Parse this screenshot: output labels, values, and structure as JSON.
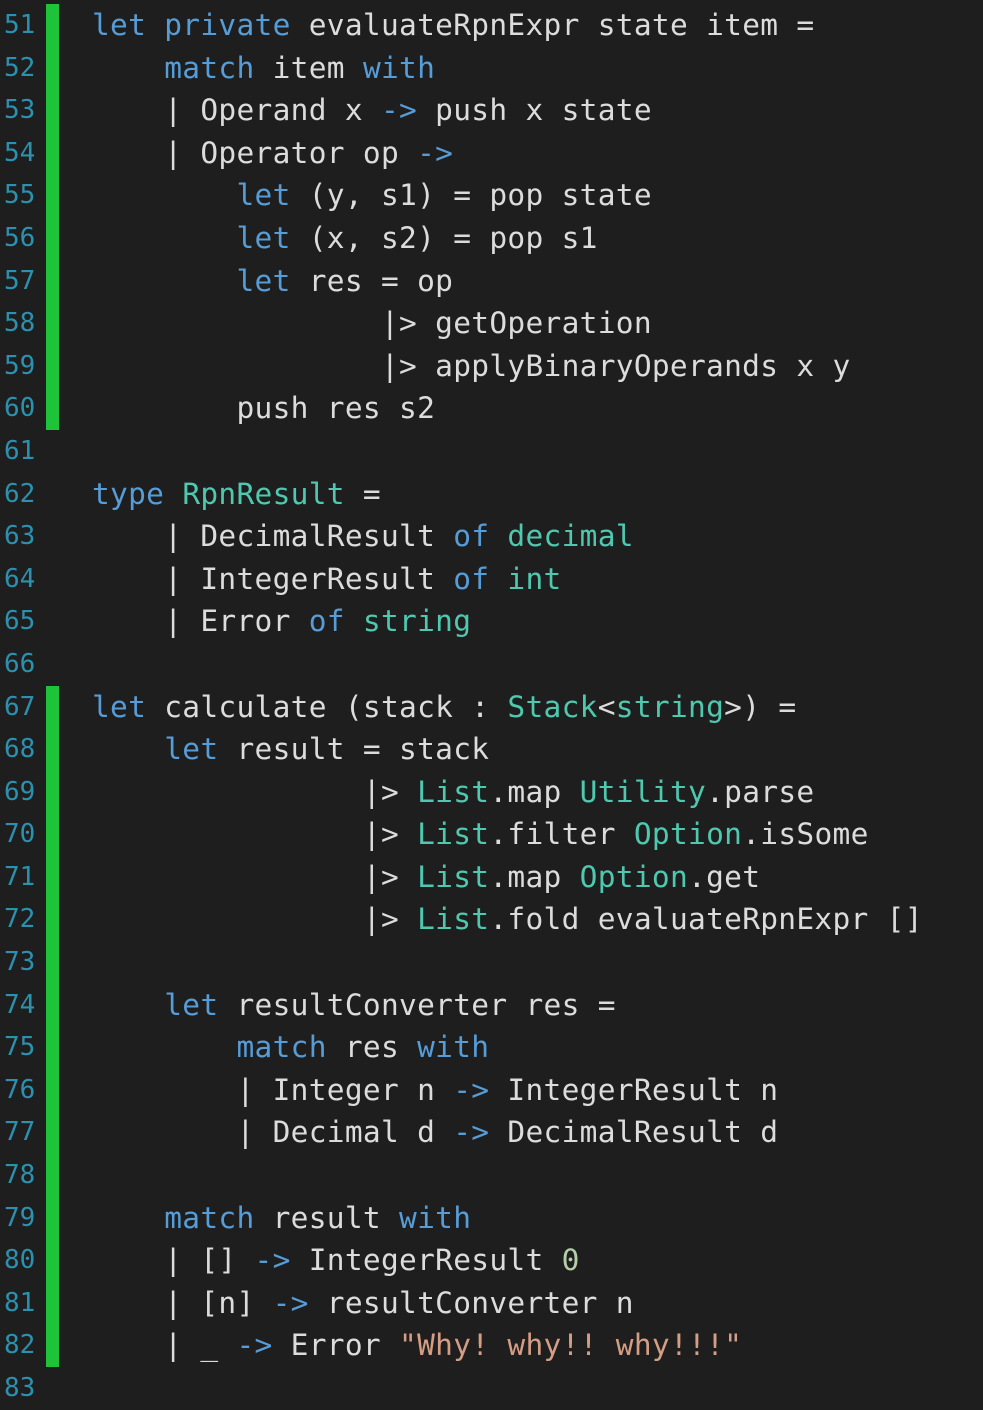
{
  "colors": {
    "background": "#1e1e1e",
    "line_number": "#2b91af",
    "change_marker": "#1fc33a",
    "keyword": "#569cd6",
    "type": "#4ec9b0",
    "string": "#d69d85",
    "number": "#b5cea8",
    "plain": "#dcdcdc"
  },
  "lines": [
    {
      "num": "51",
      "changed": true,
      "tokens": [
        {
          "t": "let",
          "k": "kw"
        },
        {
          "t": " ",
          "k": "plain"
        },
        {
          "t": "private",
          "k": "kw"
        },
        {
          "t": " evaluateRpnExpr state item =",
          "k": "plain"
        }
      ]
    },
    {
      "num": "52",
      "changed": true,
      "tokens": [
        {
          "t": "    ",
          "k": "plain"
        },
        {
          "t": "match",
          "k": "kw"
        },
        {
          "t": " item ",
          "k": "plain"
        },
        {
          "t": "with",
          "k": "kw"
        }
      ]
    },
    {
      "num": "53",
      "changed": true,
      "tokens": [
        {
          "t": "    | Operand x ",
          "k": "plain"
        },
        {
          "t": "->",
          "k": "arrow"
        },
        {
          "t": " push x state",
          "k": "plain"
        }
      ]
    },
    {
      "num": "54",
      "changed": true,
      "tokens": [
        {
          "t": "    | Operator op ",
          "k": "plain"
        },
        {
          "t": "->",
          "k": "arrow"
        }
      ]
    },
    {
      "num": "55",
      "changed": true,
      "tokens": [
        {
          "t": "        ",
          "k": "plain"
        },
        {
          "t": "let",
          "k": "kw"
        },
        {
          "t": " (y, s1) = pop state",
          "k": "plain"
        }
      ]
    },
    {
      "num": "56",
      "changed": true,
      "tokens": [
        {
          "t": "        ",
          "k": "plain"
        },
        {
          "t": "let",
          "k": "kw"
        },
        {
          "t": " (x, s2) = pop s1",
          "k": "plain"
        }
      ]
    },
    {
      "num": "57",
      "changed": true,
      "tokens": [
        {
          "t": "        ",
          "k": "plain"
        },
        {
          "t": "let",
          "k": "kw"
        },
        {
          "t": " res = op",
          "k": "plain"
        }
      ]
    },
    {
      "num": "58",
      "changed": true,
      "tokens": [
        {
          "t": "                |> getOperation",
          "k": "plain"
        }
      ]
    },
    {
      "num": "59",
      "changed": true,
      "tokens": [
        {
          "t": "                |> applyBinaryOperands x y",
          "k": "plain"
        }
      ]
    },
    {
      "num": "60",
      "changed": true,
      "tokens": [
        {
          "t": "        push res s2",
          "k": "plain"
        }
      ]
    },
    {
      "num": "61",
      "changed": false,
      "tokens": []
    },
    {
      "num": "62",
      "changed": false,
      "tokens": [
        {
          "t": "type",
          "k": "kw"
        },
        {
          "t": " ",
          "k": "plain"
        },
        {
          "t": "RpnResult",
          "k": "type"
        },
        {
          "t": " =",
          "k": "plain"
        }
      ]
    },
    {
      "num": "63",
      "changed": false,
      "tokens": [
        {
          "t": "    | DecimalResult ",
          "k": "plain"
        },
        {
          "t": "of",
          "k": "kw"
        },
        {
          "t": " ",
          "k": "plain"
        },
        {
          "t": "decimal",
          "k": "type"
        }
      ]
    },
    {
      "num": "64",
      "changed": false,
      "tokens": [
        {
          "t": "    | IntegerResult ",
          "k": "plain"
        },
        {
          "t": "of",
          "k": "kw"
        },
        {
          "t": " ",
          "k": "plain"
        },
        {
          "t": "int",
          "k": "type"
        }
      ]
    },
    {
      "num": "65",
      "changed": false,
      "tokens": [
        {
          "t": "    | Error ",
          "k": "plain"
        },
        {
          "t": "of",
          "k": "kw"
        },
        {
          "t": " ",
          "k": "plain"
        },
        {
          "t": "string",
          "k": "type"
        }
      ]
    },
    {
      "num": "66",
      "changed": false,
      "tokens": []
    },
    {
      "num": "67",
      "changed": true,
      "tokens": [
        {
          "t": "let",
          "k": "kw"
        },
        {
          "t": " calculate (stack : ",
          "k": "plain"
        },
        {
          "t": "Stack",
          "k": "type"
        },
        {
          "t": "<",
          "k": "plain"
        },
        {
          "t": "string",
          "k": "type"
        },
        {
          "t": ">) =",
          "k": "plain"
        }
      ]
    },
    {
      "num": "68",
      "changed": true,
      "tokens": [
        {
          "t": "    ",
          "k": "plain"
        },
        {
          "t": "let",
          "k": "kw"
        },
        {
          "t": " result = stack",
          "k": "plain"
        }
      ]
    },
    {
      "num": "69",
      "changed": true,
      "tokens": [
        {
          "t": "               |> ",
          "k": "plain"
        },
        {
          "t": "List",
          "k": "type"
        },
        {
          "t": ".map ",
          "k": "plain"
        },
        {
          "t": "Utility",
          "k": "type"
        },
        {
          "t": ".parse",
          "k": "plain"
        }
      ]
    },
    {
      "num": "70",
      "changed": true,
      "tokens": [
        {
          "t": "               |> ",
          "k": "plain"
        },
        {
          "t": "List",
          "k": "type"
        },
        {
          "t": ".filter ",
          "k": "plain"
        },
        {
          "t": "Option",
          "k": "type"
        },
        {
          "t": ".isSome",
          "k": "plain"
        }
      ]
    },
    {
      "num": "71",
      "changed": true,
      "tokens": [
        {
          "t": "               |> ",
          "k": "plain"
        },
        {
          "t": "List",
          "k": "type"
        },
        {
          "t": ".map ",
          "k": "plain"
        },
        {
          "t": "Option",
          "k": "type"
        },
        {
          "t": ".get",
          "k": "plain"
        }
      ]
    },
    {
      "num": "72",
      "changed": true,
      "tokens": [
        {
          "t": "               |> ",
          "k": "plain"
        },
        {
          "t": "List",
          "k": "type"
        },
        {
          "t": ".fold evaluateRpnExpr []",
          "k": "plain"
        }
      ]
    },
    {
      "num": "73",
      "changed": true,
      "tokens": []
    },
    {
      "num": "74",
      "changed": true,
      "tokens": [
        {
          "t": "    ",
          "k": "plain"
        },
        {
          "t": "let",
          "k": "kw"
        },
        {
          "t": " resultConverter res =",
          "k": "plain"
        }
      ]
    },
    {
      "num": "75",
      "changed": true,
      "tokens": [
        {
          "t": "        ",
          "k": "plain"
        },
        {
          "t": "match",
          "k": "kw"
        },
        {
          "t": " res ",
          "k": "plain"
        },
        {
          "t": "with",
          "k": "kw"
        }
      ]
    },
    {
      "num": "76",
      "changed": true,
      "tokens": [
        {
          "t": "        | Integer n ",
          "k": "plain"
        },
        {
          "t": "->",
          "k": "arrow"
        },
        {
          "t": " IntegerResult n",
          "k": "plain"
        }
      ]
    },
    {
      "num": "77",
      "changed": true,
      "tokens": [
        {
          "t": "        | Decimal d ",
          "k": "plain"
        },
        {
          "t": "->",
          "k": "arrow"
        },
        {
          "t": " DecimalResult d",
          "k": "plain"
        }
      ]
    },
    {
      "num": "78",
      "changed": true,
      "tokens": []
    },
    {
      "num": "79",
      "changed": true,
      "tokens": [
        {
          "t": "    ",
          "k": "plain"
        },
        {
          "t": "match",
          "k": "kw"
        },
        {
          "t": " result ",
          "k": "plain"
        },
        {
          "t": "with",
          "k": "kw"
        }
      ]
    },
    {
      "num": "80",
      "changed": true,
      "tokens": [
        {
          "t": "    | [] ",
          "k": "plain"
        },
        {
          "t": "->",
          "k": "arrow"
        },
        {
          "t": " IntegerResult ",
          "k": "plain"
        },
        {
          "t": "0",
          "k": "num"
        }
      ]
    },
    {
      "num": "81",
      "changed": true,
      "tokens": [
        {
          "t": "    | [n] ",
          "k": "plain"
        },
        {
          "t": "->",
          "k": "arrow"
        },
        {
          "t": " resultConverter n",
          "k": "plain"
        }
      ]
    },
    {
      "num": "82",
      "changed": true,
      "tokens": [
        {
          "t": "    | _ ",
          "k": "plain"
        },
        {
          "t": "->",
          "k": "arrow"
        },
        {
          "t": " Error ",
          "k": "plain"
        },
        {
          "t": "\"Why! why!! why!!!\"",
          "k": "str"
        }
      ]
    },
    {
      "num": "83",
      "changed": false,
      "tokens": []
    }
  ]
}
